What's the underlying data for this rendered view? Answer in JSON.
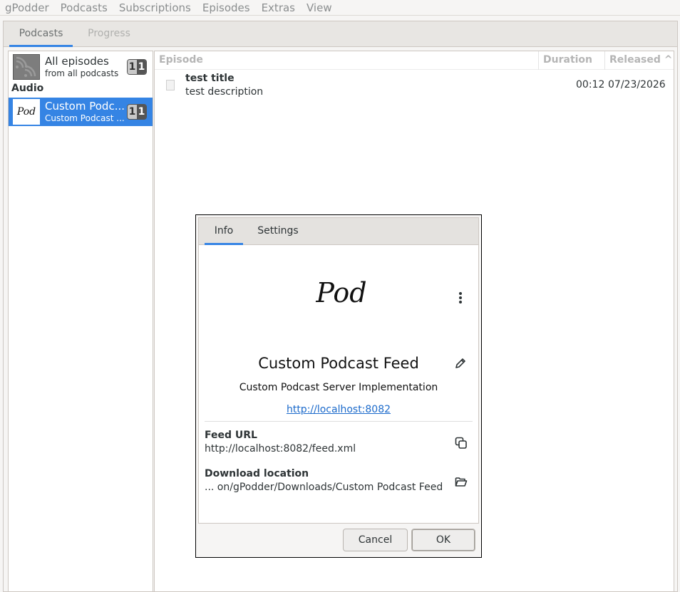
{
  "menubar": {
    "items": [
      "gPodder",
      "Podcasts",
      "Subscriptions",
      "Episodes",
      "Extras",
      "View"
    ]
  },
  "main_tabs": {
    "podcasts": "Podcasts",
    "progress": "Progress"
  },
  "podcast_list": {
    "all": {
      "title": "All episodes",
      "subtitle": "from all podcasts",
      "badge_left": "1",
      "badge_right": "1"
    },
    "section": "Audio",
    "selected": {
      "cover_text": "Pod",
      "title": "Custom Podc...",
      "subtitle": "Custom Podcast ...",
      "badge_left": "1",
      "badge_right": "1"
    }
  },
  "episode_list": {
    "headers": {
      "episode": "Episode",
      "duration": "Duration",
      "released": "Released ^"
    },
    "rows": [
      {
        "title": "test title",
        "description": "test description",
        "duration": "00:12",
        "released": "07/23/2026"
      }
    ]
  },
  "dialog": {
    "tabs": {
      "info": "Info",
      "settings": "Settings"
    },
    "cover_text": "Pod",
    "title": "Custom Podcast Feed",
    "description": "Custom Podcast Server Implementation",
    "link": "http://localhost:8082",
    "feed_url_label": "Feed URL",
    "feed_url_value": "http://localhost:8082/feed.xml",
    "download_label": "Download location",
    "download_value": "... on/gPodder/Downloads/Custom Podcast Feed",
    "cancel": "Cancel",
    "ok": "OK"
  }
}
